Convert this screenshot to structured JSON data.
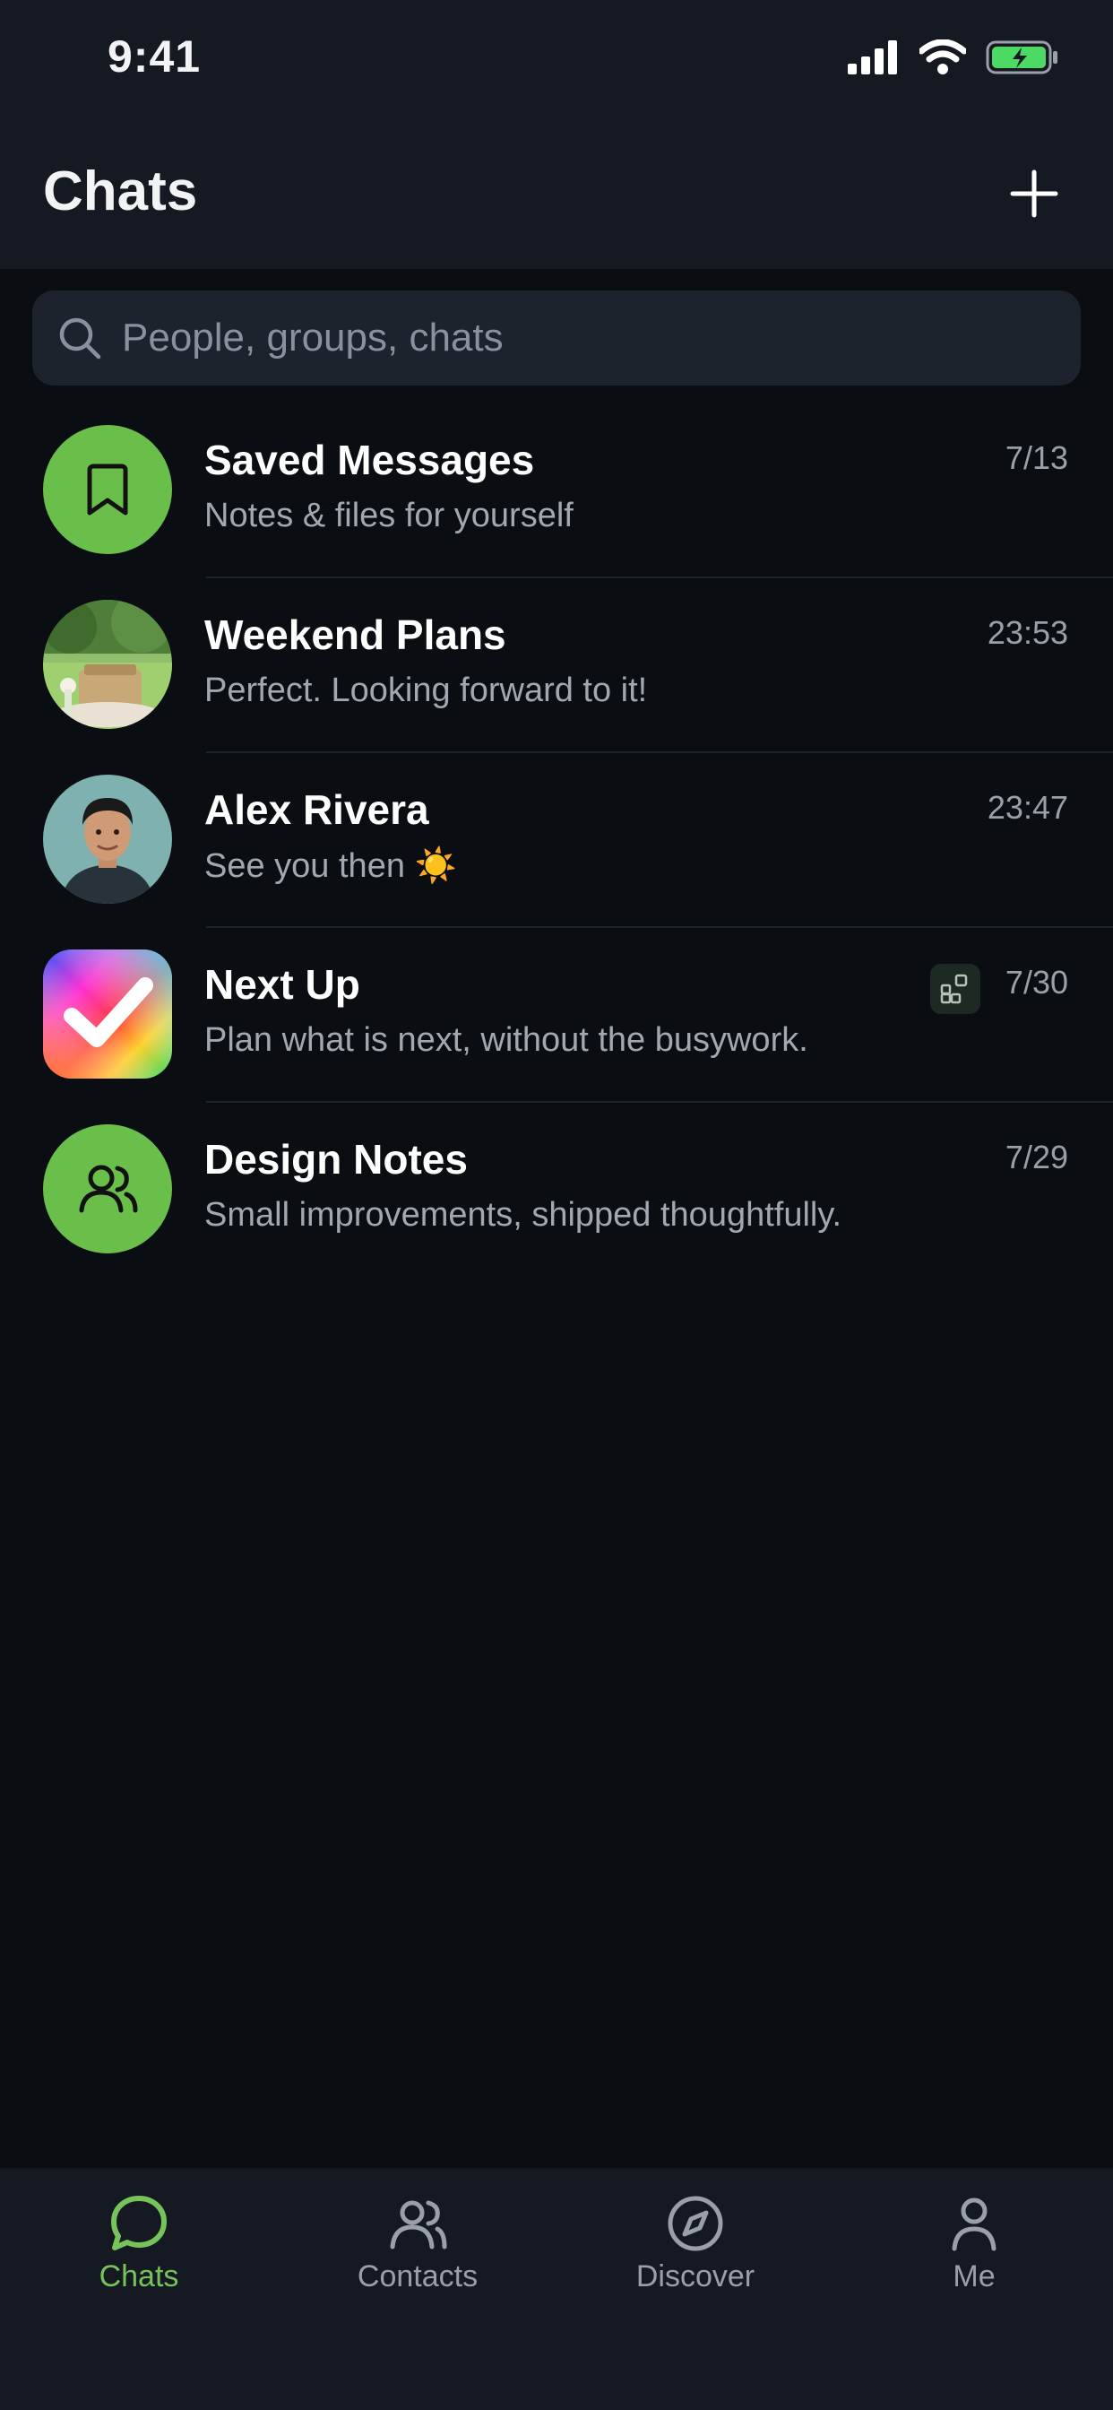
{
  "status_bar": {
    "time": "9:41"
  },
  "header": {
    "title": "Chats",
    "action_icon": "plus-icon"
  },
  "search": {
    "placeholder": "People, groups, chats",
    "icon": "search-icon"
  },
  "chats": [
    {
      "name": "Saved Messages",
      "preview": "Notes & files for yourself",
      "time": "7/13",
      "avatar": "bookmark-icon"
    },
    {
      "name": "Weekend Plans",
      "preview": "Perfect. Looking forward to it!",
      "time": "23:53",
      "avatar": "picnic-photo"
    },
    {
      "name": "Alex Rivera",
      "preview": "See you then ☀️",
      "time": "23:47",
      "avatar": "person-photo"
    },
    {
      "name": "Next Up",
      "preview": "Plan what is next, without the busywork.",
      "time": "7/30",
      "avatar": "checkmark-app-icon",
      "badge": "mini-app-icon"
    },
    {
      "name": "Design Notes",
      "preview": "Small improvements, shipped thoughtfully.",
      "time": "7/29",
      "avatar": "group-icon"
    }
  ],
  "tabs": [
    {
      "label": "Chats",
      "icon": "chat-bubble-icon",
      "active": true
    },
    {
      "label": "Contacts",
      "icon": "contacts-icon"
    },
    {
      "label": "Discover",
      "icon": "compass-icon"
    },
    {
      "label": "Me",
      "icon": "person-icon"
    }
  ],
  "colors": {
    "accent": "#6abf4b",
    "background": "#0a0d12",
    "header": "#141922"
  }
}
